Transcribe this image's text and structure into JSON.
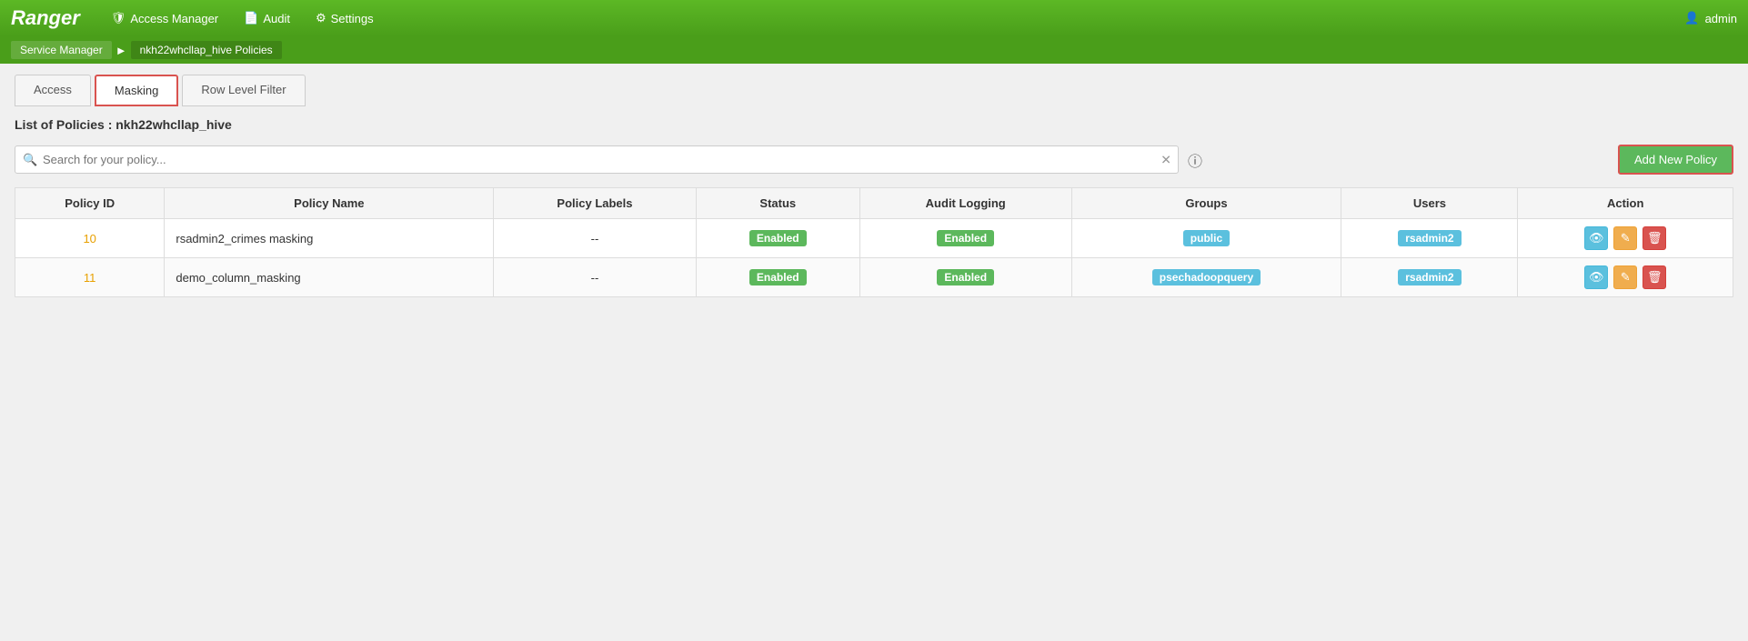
{
  "app": {
    "logo": "Ranger",
    "nav": [
      {
        "id": "access-manager",
        "label": "Access Manager",
        "icon": "shield"
      },
      {
        "id": "audit",
        "label": "Audit",
        "icon": "file"
      },
      {
        "id": "settings",
        "label": "Settings",
        "icon": "gear"
      }
    ],
    "admin_label": "admin",
    "admin_icon": "user"
  },
  "breadcrumb": {
    "items": [
      {
        "id": "service-manager",
        "label": "Service Manager"
      },
      {
        "id": "policies",
        "label": "nkh22whcllap_hive Policies"
      }
    ]
  },
  "tabs": [
    {
      "id": "access",
      "label": "Access",
      "active": false
    },
    {
      "id": "masking",
      "label": "Masking",
      "active": true
    },
    {
      "id": "row-level-filter",
      "label": "Row Level Filter",
      "active": false
    }
  ],
  "page_title": "List of Policies : nkh22whcllap_hive",
  "search": {
    "placeholder": "Search for your policy...",
    "value": ""
  },
  "add_button_label": "Add New Policy",
  "table": {
    "columns": [
      "Policy ID",
      "Policy Name",
      "Policy Labels",
      "Status",
      "Audit Logging",
      "Groups",
      "Users",
      "Action"
    ],
    "rows": [
      {
        "id": "10",
        "name": "rsadmin2_crimes masking",
        "labels": "--",
        "status": "Enabled",
        "audit_logging": "Enabled",
        "groups": "public",
        "users": "rsadmin2"
      },
      {
        "id": "11",
        "name": "demo_column_masking",
        "labels": "--",
        "status": "Enabled",
        "audit_logging": "Enabled",
        "groups": "psechadoopquery",
        "users": "rsadmin2"
      }
    ]
  },
  "icons": {
    "search": "🔍",
    "clear": "✕",
    "info": "ℹ",
    "shield": "🛡",
    "file": "📄",
    "gear": "⚙",
    "user": "👤",
    "view": "👁",
    "edit": "✏",
    "delete": "🗑",
    "arrow_right": "▶"
  }
}
